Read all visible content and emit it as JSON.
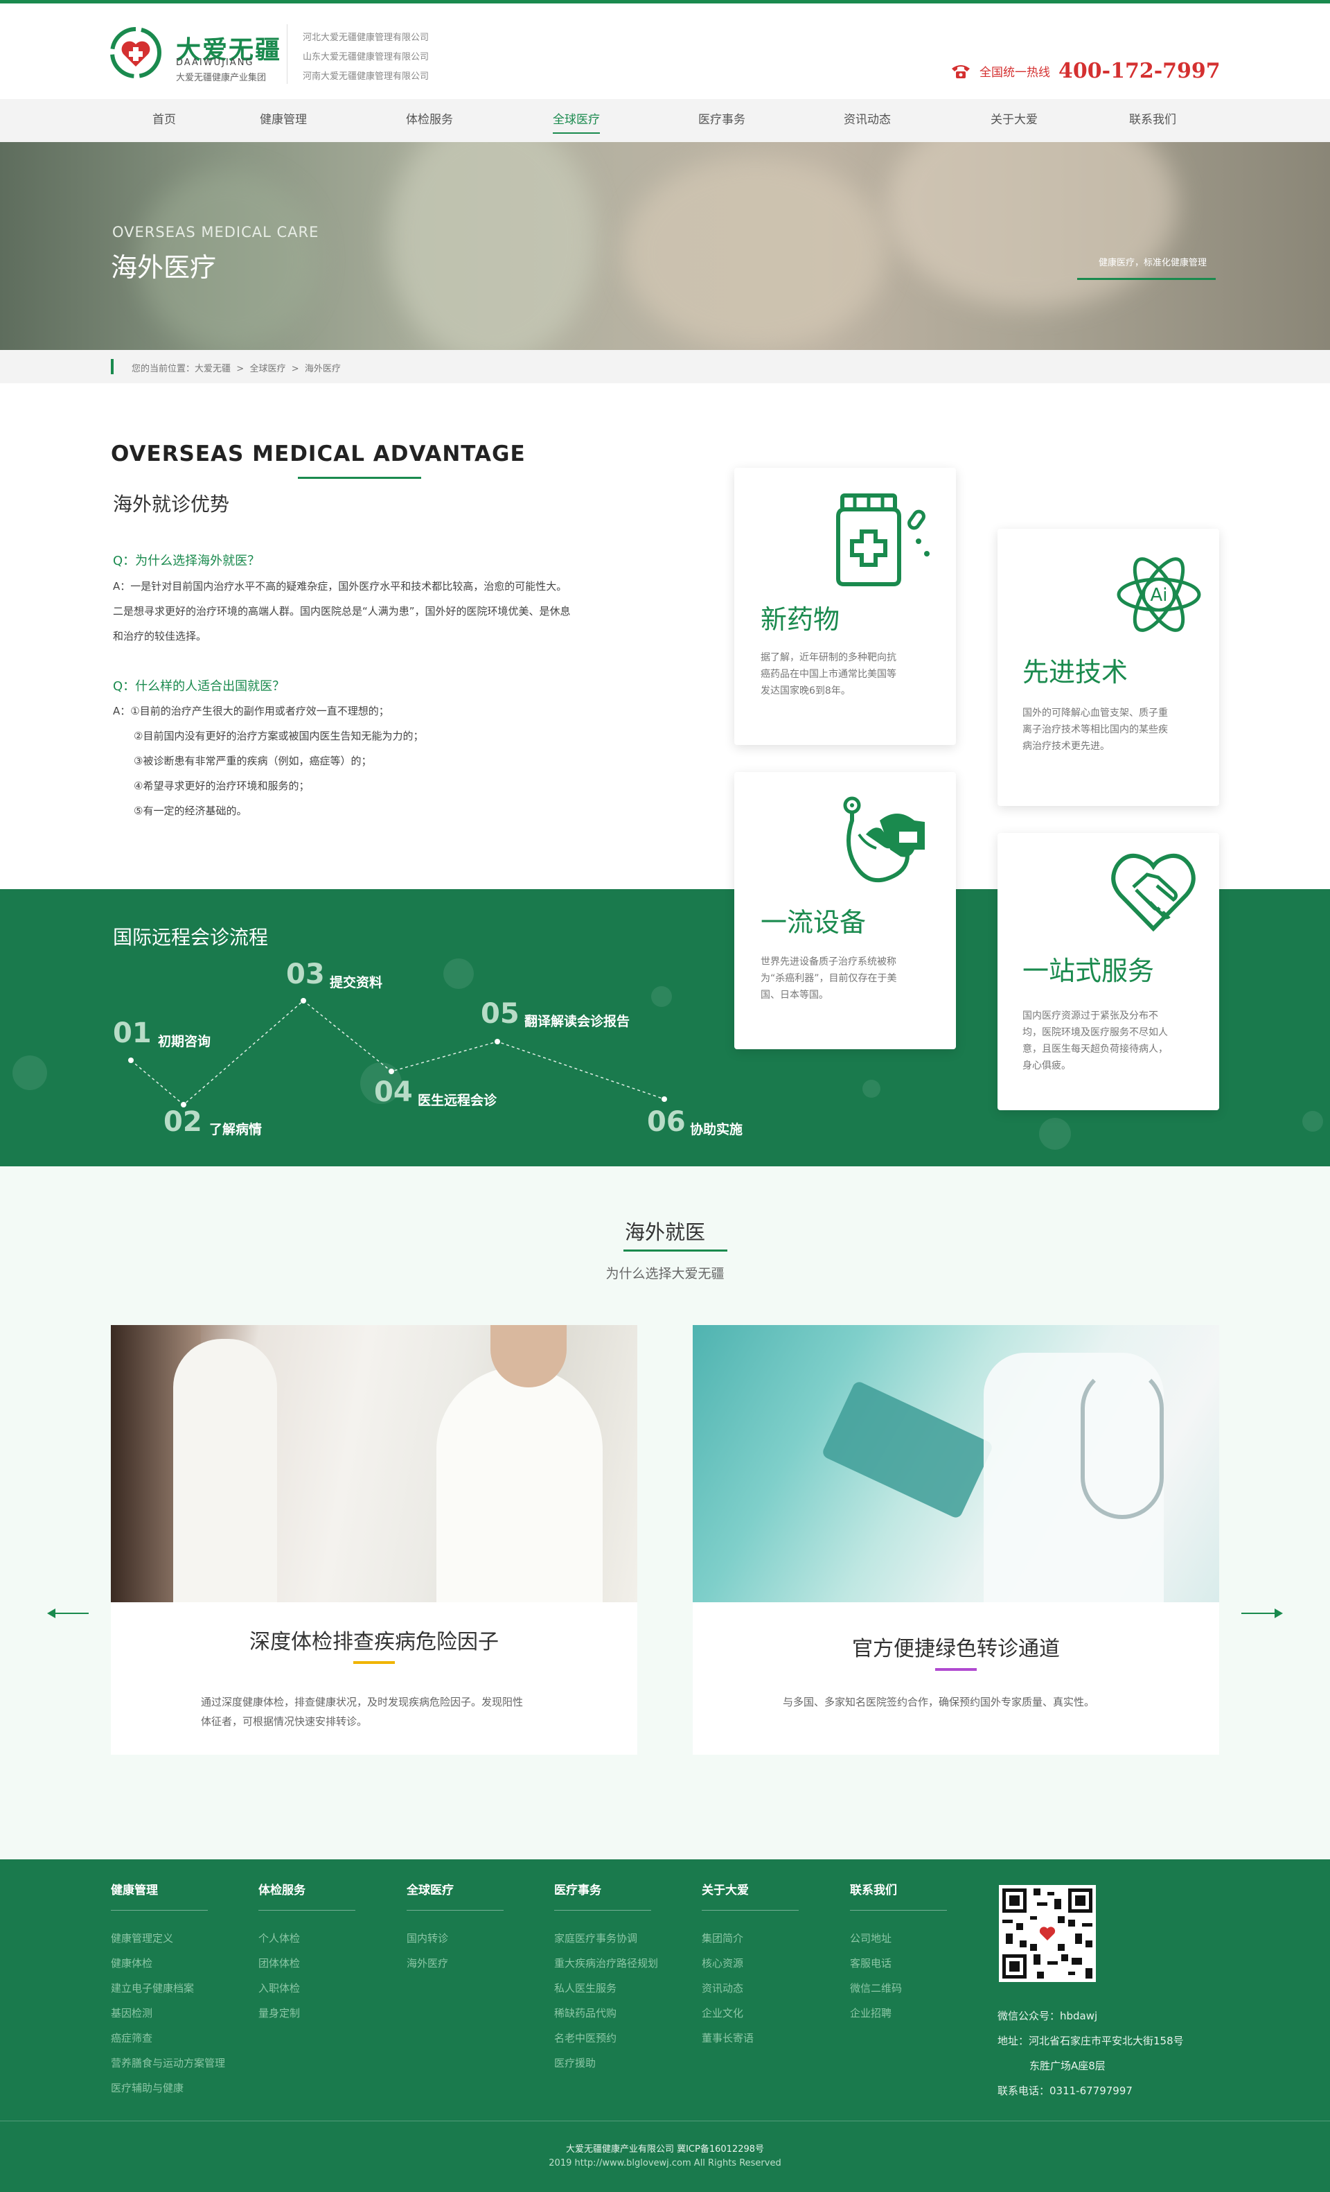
{
  "brand": {
    "name_cn": "大爱无疆",
    "name_en": "DAAIWUJIANG",
    "tagline": "大爱无疆健康产业集团",
    "companies": [
      "河北大爱无疆健康管理有限公司",
      "山东大爱无疆健康管理有限公司",
      "河南大爱无疆健康管理有限公司"
    ]
  },
  "hotline": {
    "label": "全国统一热线",
    "number": "400-172-7997"
  },
  "nav": [
    "首页",
    "健康管理",
    "体检服务",
    "全球医疗",
    "医疗事务",
    "资讯动态",
    "关于大爱",
    "联系我们"
  ],
  "nav_active": "全球医疗",
  "banner": {
    "title_en": "OVERSEAS MEDICAL CARE",
    "title_cn": "海外医疗",
    "tag": "健康医疗，标准化健康管理"
  },
  "breadcrumb": {
    "prefix": "您的当前位置：",
    "items": [
      "大爱无疆",
      "全球医疗",
      "海外医疗"
    ],
    "sep": ">"
  },
  "advantage": {
    "title_en": "OVERSEAS MEDICAL ADVANTAGE",
    "title_cn": "海外就诊优势",
    "q1": "Q：为什么选择海外就医？",
    "a1": [
      "A：一是针对目前国内治疗水平不高的疑难杂症，国外医疗水平和技术都比较高，治愈的可能性大。",
      "二是想寻求更好的治疗环境的高端人群。国内医院总是“人满为患”，国外好的医院环境优美、是休息",
      "和治疗的较佳选择。"
    ],
    "q2": "Q：什么样的人适合出国就医？",
    "a2": [
      "A：①目前的治疗产生很大的副作用或者疗效一直不理想的；",
      "②目前国内没有更好的治疗方案或被国内医生告知无能为力的；",
      "③被诊断患有非常严重的疾病（例如，癌症等）的；",
      "④希望寻求更好的治疗环境和服务的；",
      "⑤有一定的经济基础的。"
    ]
  },
  "cards": [
    {
      "title": "新药物",
      "desc": [
        "据了解，近年研制的多种靶向抗",
        "癌药品在中国上市通常比美国等",
        "发达国家晚6到8年。"
      ],
      "icon": "medicine-bottle-icon"
    },
    {
      "title": "先进技术",
      "desc": [
        "国外的可降解心血管支架、质子重",
        "离子治疗技术等相比国内的某些疾",
        "病治疗技术更先进。"
      ],
      "icon": "ai-atom-icon"
    },
    {
      "title": "一流设备",
      "desc": [
        "世界先进设备质子治疗系统被称",
        "为“杀癌利器”，目前仅存在于美",
        "国、日本等国。"
      ],
      "icon": "stethoscope-icon"
    },
    {
      "title": "一站式服务",
      "desc": [
        "国内医疗资源过于紧张及分布不",
        "均，医院环境及医疗服务不尽如人",
        "意，且医生每天超负荷接待病人，",
        "身心俱疲。"
      ],
      "icon": "heart-handshake-icon"
    }
  ],
  "process": {
    "title": "国际远程会诊流程",
    "steps": [
      {
        "num": "01",
        "label": "初期咨询"
      },
      {
        "num": "02",
        "label": "了解病情"
      },
      {
        "num": "03",
        "label": "提交资料"
      },
      {
        "num": "04",
        "label": "医生远程会诊"
      },
      {
        "num": "05",
        "label": "翻译解读会诊报告"
      },
      {
        "num": "06",
        "label": "协助实施"
      }
    ]
  },
  "why": {
    "title": "海外就医",
    "subtitle": "为什么选择大爱无疆",
    "items": [
      {
        "title": "深度体检排查疾病危险因子",
        "desc": [
          "通过深度健康体检，排查健康状况，及时发现疾病危险因子。发现阳性",
          "体征者，可根据情况快速安排转诊。"
        ],
        "accent": "#f0b400"
      },
      {
        "title": "官方便捷绿色转诊通道",
        "desc": [
          "与多国、多家知名医院签约合作，确保预约国外专家质量、真实性。"
        ],
        "accent": "#b04ad0"
      }
    ]
  },
  "footer": {
    "columns": [
      {
        "head": "健康管理",
        "links": [
          "健康管理定义",
          "健康体检",
          "建立电子健康档案",
          "基因检测",
          "癌症筛查",
          "营养膳食与运动方案管理",
          "医疗辅助与健康"
        ]
      },
      {
        "head": "体检服务",
        "links": [
          "个人体检",
          "团体体检",
          "入职体检",
          "量身定制"
        ]
      },
      {
        "head": "全球医疗",
        "links": [
          "国内转诊",
          "海外医疗"
        ]
      },
      {
        "head": "医疗事务",
        "links": [
          "家庭医疗事务协调",
          "重大疾病治疗路径规划",
          "私人医生服务",
          "稀缺药品代购",
          "名老中医预约",
          "医疗援助"
        ]
      },
      {
        "head": "关于大爱",
        "links": [
          "集团简介",
          "核心资源",
          "资讯动态",
          "企业文化",
          "董事长寄语"
        ]
      },
      {
        "head": "联系我们",
        "links": [
          "公司地址",
          "客服电话",
          "微信二维码",
          "企业招聘"
        ]
      }
    ],
    "wechat": "微信公众号：hbdawj",
    "address1": "地址：河北省石家庄市平安北大街158号",
    "address2": "东胜广场A座8层",
    "phone": "联系电话：0311-67797997",
    "copyright": "大爱无疆健康产业有限公司 冀ICP备16012298号",
    "copyright2": "2019 http://www.blglovewj.com All Rights Reserved"
  },
  "colors": {
    "primary": "#1a8a4e",
    "band": "#1a7a4d",
    "hotline": "#d43030"
  }
}
